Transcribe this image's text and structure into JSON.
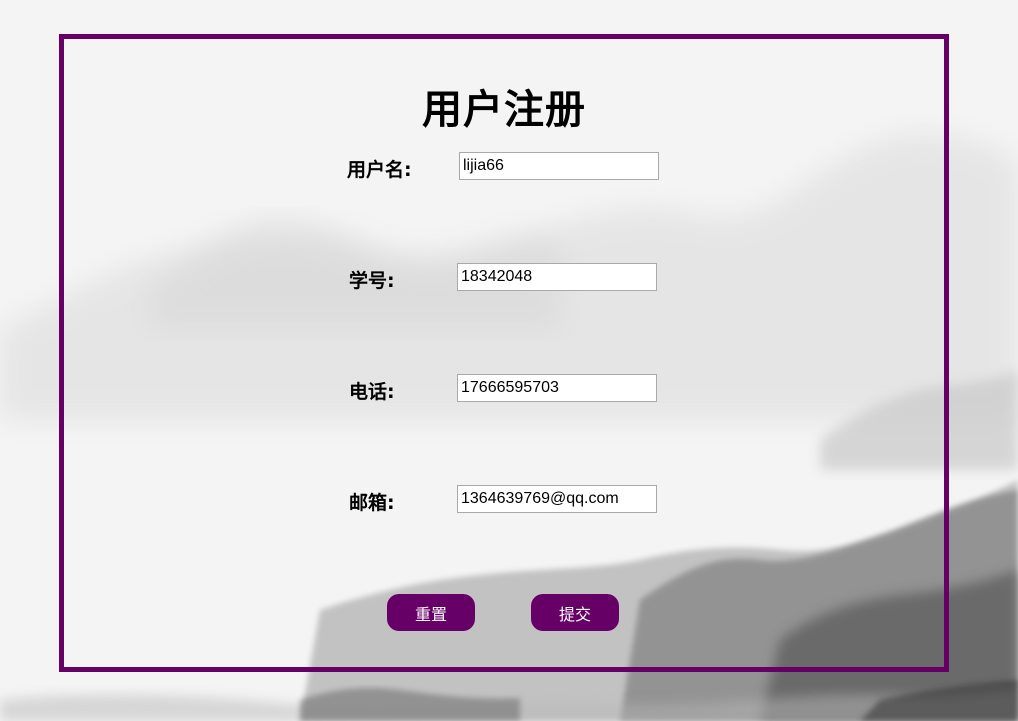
{
  "form": {
    "title": "用户注册",
    "fields": [
      {
        "label": "用户名:",
        "value": "lijia66"
      },
      {
        "label": "学号:",
        "value": "18342048"
      },
      {
        "label": "电话:",
        "value": "17666595703"
      },
      {
        "label": "邮箱:",
        "value": "1364639769@qq.com"
      }
    ],
    "reset_label": "重置",
    "submit_label": "提交"
  },
  "colors": {
    "accent": "#660066",
    "background": "#f4f4f4"
  }
}
